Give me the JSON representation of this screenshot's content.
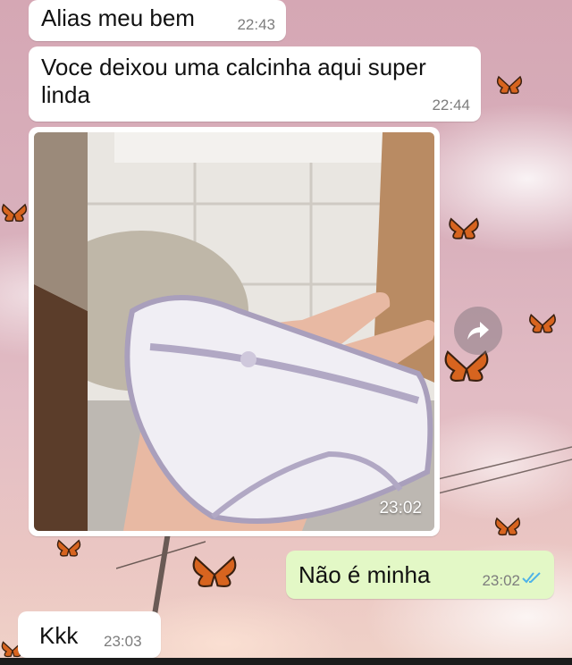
{
  "messages": [
    {
      "direction": "in",
      "text": "Alias meu bem",
      "time": "22:43"
    },
    {
      "direction": "in",
      "text": "Voce deixou uma calcinha aqui super linda",
      "time": "22:44"
    },
    {
      "direction": "in",
      "type": "image",
      "time": "23:02"
    },
    {
      "direction": "out",
      "text": "Não é minha",
      "time": "23:02",
      "status": "read"
    },
    {
      "direction": "in",
      "text": "Kkk",
      "time": "23:03"
    }
  ],
  "icons": {
    "forward": "forward-arrow-icon",
    "read_receipt": "double-check-icon",
    "decor": "butterfly-icon"
  },
  "colors": {
    "incoming_bubble": "#ffffff",
    "outgoing_bubble": "#e3f8c6",
    "read_tick": "#4fb3e8",
    "wallpaper": "#d9b0bc"
  }
}
